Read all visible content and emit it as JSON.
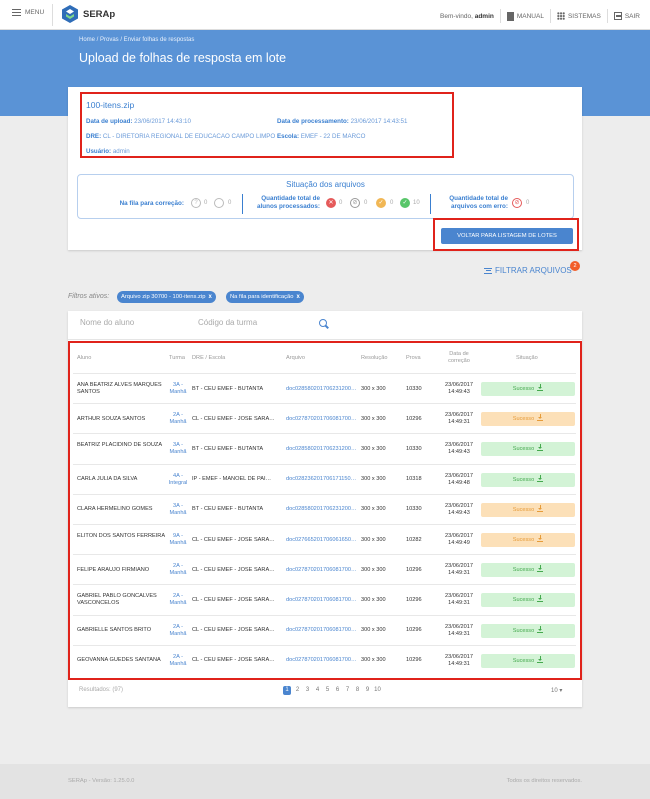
{
  "header": {
    "menu_label": "MENU",
    "app_name": "SERAp",
    "welcome_prefix": "Bem-vindo,",
    "user": "admin",
    "manual": "MANUAL",
    "sistemas": "SISTEMAS",
    "sair": "SAIR"
  },
  "breadcrumb": "Home / Provas / Enviar folhas de respostas",
  "page_title": "Upload de folhas de resposta em lote",
  "file": {
    "name": "100-itens.zip",
    "upload_label": "Data de upload:",
    "upload_value": "23/06/2017 14:43:10",
    "proc_label": "Data de processamento:",
    "proc_value": "23/06/2017 14:43:51",
    "dre_label": "DRE:",
    "dre_value": "CL - DIRETORIA REGIONAL DE EDUCACAO CAMPO LIMPO",
    "escola_label": "Escola:",
    "escola_value": "EMEF - 22 DE MARCO",
    "usuario_label": "Usuário:",
    "usuario_value": "admin"
  },
  "situacao": {
    "title": "Situação dos arquivos",
    "fila_label": "Na fila para correção:",
    "fila_counts": [
      "0",
      "0"
    ],
    "proc_label": "Quantidade total de alunos processados:",
    "proc_counts": [
      "0",
      "0",
      "0",
      "10"
    ],
    "erro_label": "Quantidade total de arquivos com erro:",
    "erro_counts": [
      "0"
    ]
  },
  "back_button": "VOLTAR PARA LISTAGEM DE LOTES",
  "filter_button": "FILTRAR ARQUIVOS",
  "filter_count": "2",
  "filters": {
    "label": "Filtros ativos:",
    "chips": [
      "Arquivo zip 30700 - 100-itens.zip",
      "Na fila para identificação"
    ],
    "remove": "x"
  },
  "search": {
    "aluno_placeholder": "Nome do aluno",
    "turma_placeholder": "Código da turma"
  },
  "table": {
    "headers": {
      "aluno": "Aluno",
      "turma": "Turma",
      "dre": "DRE / Escola",
      "arquivo": "Arquivo",
      "resolucao": "Resolução",
      "prova": "Prova",
      "data": "Data de correção",
      "situacao": "Situação"
    },
    "rows": [
      {
        "aluno": "ANA BEATRIZ ALVES MARQUES SANTOS",
        "turma": "3A - Manhã",
        "dre": "BT - CEU EMEF - BUTANTA",
        "arquivo": "doc028580201706231200…",
        "res": "300 x 300",
        "prova": "10330",
        "data": "23/06/2017 14:49:43",
        "sit": "Sucesso",
        "st": "ok"
      },
      {
        "aluno": "ARTHUR SOUZA SANTOS",
        "turma": "2A - Manhã",
        "dre": "CL - CEU EMEF - JOSE SARA…",
        "arquivo": "doc027870201706081700…",
        "res": "300 x 300",
        "prova": "10296",
        "data": "23/06/2017 14:49:31",
        "sit": "Sucesso",
        "st": "warn"
      },
      {
        "aluno": "BEATRIZ PLACIDINO DE SOUZA",
        "turma": "3A - Manhã",
        "dre": "BT - CEU EMEF - BUTANTA",
        "arquivo": "doc028580201706231200…",
        "res": "300 x 300",
        "prova": "10330",
        "data": "23/06/2017 14:49:43",
        "sit": "Sucesso",
        "st": "ok"
      },
      {
        "aluno": "CARLA JULIA DA SILVA",
        "turma": "4A - Integral",
        "dre": "IP - EMEF - MANOEL DE PAI…",
        "arquivo": "doc028236201706171150…",
        "res": "300 x 300",
        "prova": "10318",
        "data": "23/06/2017 14:49:48",
        "sit": "Sucesso",
        "st": "ok"
      },
      {
        "aluno": "CLARA HERMELINO GOMES",
        "turma": "3A - Manhã",
        "dre": "BT - CEU EMEF - BUTANTA",
        "arquivo": "doc028580201706231200…",
        "res": "300 x 300",
        "prova": "10330",
        "data": "23/06/2017 14:49:43",
        "sit": "Sucesso",
        "st": "warn"
      },
      {
        "aluno": "ELITON DOS SANTOS FERREIRA",
        "turma": "9A - Manhã",
        "dre": "CL - CEU EMEF - JOSE SARA…",
        "arquivo": "doc027665201706061650…",
        "res": "300 x 300",
        "prova": "10282",
        "data": "23/06/2017 14:49:49",
        "sit": "Sucesso",
        "st": "warn"
      },
      {
        "aluno": "FELIPE ARAUJO FIRMIANO",
        "turma": "2A - Manhã",
        "dre": "CL - CEU EMEF - JOSE SARA…",
        "arquivo": "doc027870201706081700…",
        "res": "300 x 300",
        "prova": "10296",
        "data": "23/06/2017 14:49:31",
        "sit": "Sucesso",
        "st": "ok"
      },
      {
        "aluno": "GABRIEL PABLO GONCALVES VASCONCELOS",
        "turma": "2A - Manhã",
        "dre": "CL - CEU EMEF - JOSE SARA…",
        "arquivo": "doc027870201706081700…",
        "res": "300 x 300",
        "prova": "10296",
        "data": "23/06/2017 14:49:31",
        "sit": "Sucesso",
        "st": "ok"
      },
      {
        "aluno": "GABRIELLE SANTOS BRITO",
        "turma": "2A - Manhã",
        "dre": "CL - CEU EMEF - JOSE SARA…",
        "arquivo": "doc027870201706081700…",
        "res": "300 x 300",
        "prova": "10296",
        "data": "23/06/2017 14:49:31",
        "sit": "Sucesso",
        "st": "ok"
      },
      {
        "aluno": "GEOVANNA GUEDES SANTANA",
        "turma": "2A - Manhã",
        "dre": "CL - CEU EMEF - JOSE SARA…",
        "arquivo": "doc027870201706081700…",
        "res": "300 x 300",
        "prova": "10296",
        "data": "23/06/2017 14:49:31",
        "sit": "Sucesso",
        "st": "ok"
      }
    ]
  },
  "results": "Resultados: (97)",
  "pages": [
    "1",
    "2",
    "3",
    "4",
    "5",
    "6",
    "7",
    "8",
    "9",
    "10"
  ],
  "current_page": "1",
  "page_size": "10",
  "page_size_arrow": "▾",
  "footer": {
    "left": "SERAp - Versão: 1.25.0.0",
    "right": "Todos os direitos reservados."
  },
  "colors": {
    "primary": "#4a85cf",
    "banner": "#5a93d6",
    "highlight": "#e0231b",
    "success_bg": "#d3f3d6",
    "warning_bg": "#fce0b8"
  }
}
